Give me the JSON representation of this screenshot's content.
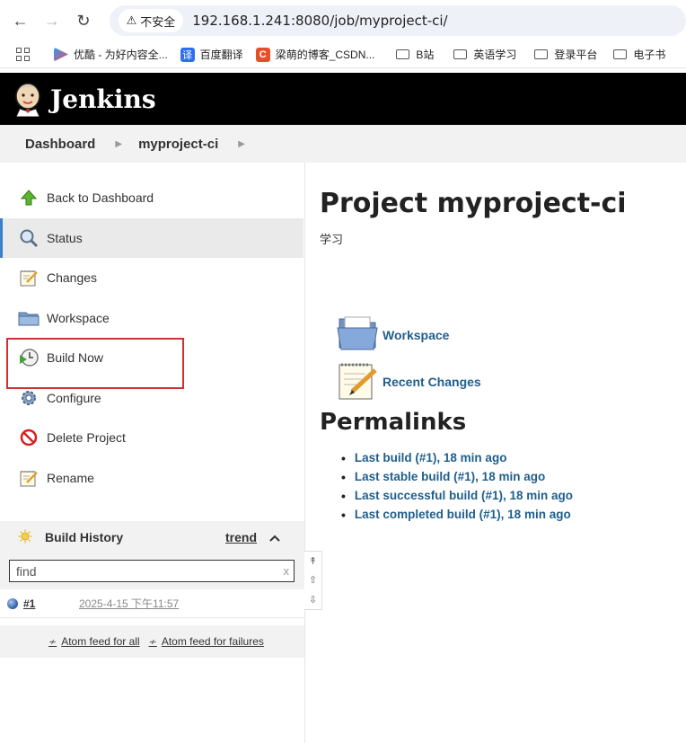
{
  "browser": {
    "security_label": "不安全",
    "url": "192.168.1.241:8080/job/myproject-ci/",
    "bookmarks": [
      {
        "label": "优酷 - 为好内容全...",
        "icon": "youku-icon"
      },
      {
        "label": "百度翻译",
        "icon": "baidu-translate-icon"
      },
      {
        "label": "梁萌的博客_CSDN...",
        "icon": "csdn-icon"
      },
      {
        "label": "B站",
        "icon": "folder-icon"
      },
      {
        "label": "英语学习",
        "icon": "folder-icon"
      },
      {
        "label": "登录平台",
        "icon": "folder-icon"
      },
      {
        "label": "电子书",
        "icon": "folder-icon"
      }
    ]
  },
  "header": {
    "title": "Jenkins"
  },
  "breadcrumb": {
    "items": [
      "Dashboard",
      "myproject-ci"
    ]
  },
  "sidebar": {
    "tasks": [
      {
        "label": "Back to Dashboard",
        "icon": "up-arrow-icon"
      },
      {
        "label": "Status",
        "icon": "magnifier-icon"
      },
      {
        "label": "Changes",
        "icon": "notepad-icon"
      },
      {
        "label": "Workspace",
        "icon": "folder-icon"
      },
      {
        "label": "Build Now",
        "icon": "clock-play-icon"
      },
      {
        "label": "Configure",
        "icon": "gear-icon"
      },
      {
        "label": "Delete Project",
        "icon": "no-entry-icon"
      },
      {
        "label": "Rename",
        "icon": "notepad-icon"
      }
    ],
    "build_history": {
      "title": "Build History",
      "trend_label": "trend",
      "search_placeholder": "find",
      "search_clear": "x",
      "builds": [
        {
          "number": "#1",
          "date": "2025-4-15 下午11:57"
        }
      ],
      "feeds": [
        "Atom feed for all",
        "Atom feed for failures"
      ]
    }
  },
  "main": {
    "title": "Project myproject-ci",
    "description": "学习",
    "links": [
      "Workspace",
      "Recent Changes"
    ],
    "permalinks_title": "Permalinks",
    "permalinks": [
      "Last build (#1), 18 min ago",
      "Last stable build (#1), 18 min ago",
      "Last successful build (#1), 18 min ago",
      "Last completed build (#1), 18 min ago"
    ]
  },
  "colors": {
    "header_bg": "#000000",
    "link": "#1f5e8c",
    "active_accent": "#3a80c8",
    "highlight": "#d32f2f"
  }
}
